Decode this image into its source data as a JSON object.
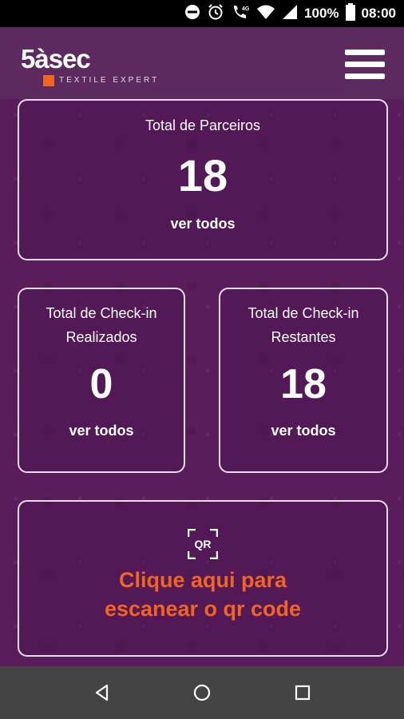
{
  "status_bar": {
    "battery": "100%",
    "time": "08:00",
    "network": "4G",
    "icons": [
      "do-not-disturb-icon",
      "alarm-icon",
      "wifi-call-icon",
      "wifi-icon",
      "signal-icon",
      "battery-icon"
    ]
  },
  "header": {
    "logo_text": "5àsec",
    "logo_tagline": "TEXTILE EXPERT",
    "menu_icon": "hamburger-menu-icon"
  },
  "cards": {
    "parceiros": {
      "title": "Total de Parceiros",
      "value": "18",
      "link": "ver todos"
    },
    "realizados": {
      "title_line1": "Total de Check-in",
      "title_line2": "Realizados",
      "value": "0",
      "link": "ver todos"
    },
    "restantes": {
      "title_line1": "Total de Check-in",
      "title_line2": "Restantes",
      "value": "18",
      "link": "ver todos"
    },
    "qr": {
      "icon_text": "QR",
      "line1": "Clique aqui para",
      "line2": "escanear o qr code"
    }
  },
  "colors": {
    "background": "#5a1d5c",
    "accent": "#f26422",
    "card_border": "#e9dde9",
    "nav_bar": "#444444"
  },
  "nav_bar": {
    "buttons": [
      "back-icon",
      "home-icon",
      "recents-icon"
    ]
  }
}
